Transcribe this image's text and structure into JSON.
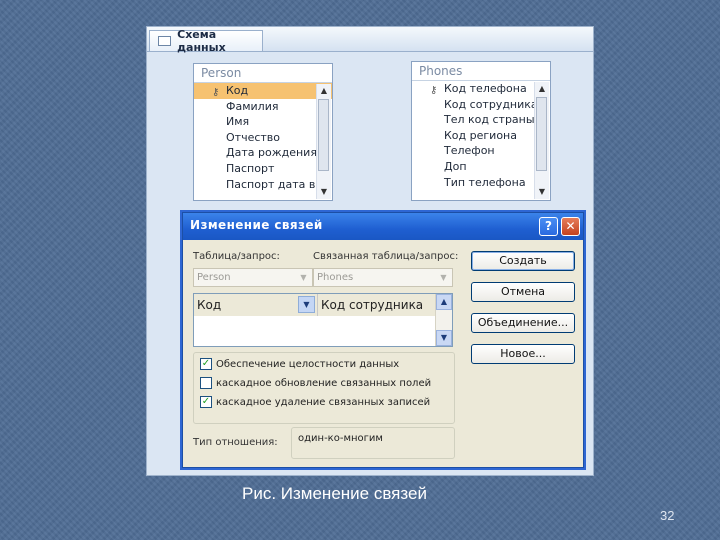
{
  "relationships_window": {
    "tab_label": "Схема данных",
    "tables": [
      {
        "name": "Person",
        "fields": [
          {
            "label": "Код",
            "key": true,
            "selected": true
          },
          {
            "label": "Фамилия"
          },
          {
            "label": "Имя"
          },
          {
            "label": "Отчество"
          },
          {
            "label": "Дата рождения"
          },
          {
            "label": "Паспорт"
          },
          {
            "label": "Паспорт дата вы"
          }
        ]
      },
      {
        "name": "Phones",
        "fields": [
          {
            "label": "Код телефона",
            "key": true
          },
          {
            "label": "Код сотрудника"
          },
          {
            "label": "Тел код страны"
          },
          {
            "label": "Код региона"
          },
          {
            "label": "Телефон"
          },
          {
            "label": "Доп"
          },
          {
            "label": "Тип телефона"
          }
        ]
      }
    ]
  },
  "dialog": {
    "title": "Изменение связей",
    "help_button": "?",
    "close_button": "✕",
    "table_query_label": "Таблица/запрос:",
    "related_table_label": "Связанная таблица/запрос:",
    "table_value": "Person",
    "related_value": "Phones",
    "join_row": {
      "left": "Код",
      "right": "Код сотрудника"
    },
    "checkboxes": [
      {
        "label": "Обеспечение целостности данных",
        "checked": true
      },
      {
        "label": "каскадное обновление связанных полей",
        "checked": false
      },
      {
        "label": "каскадное удаление связанных записей",
        "checked": true
      }
    ],
    "relationship_type_label": "Тип отношения:",
    "relationship_type_value": "один-ко-многим",
    "buttons": {
      "create": "Создать",
      "cancel": "Отмена",
      "join": "Объединение...",
      "new": "Новое..."
    }
  },
  "caption": "Рис. Изменение связей",
  "page_number": "32"
}
